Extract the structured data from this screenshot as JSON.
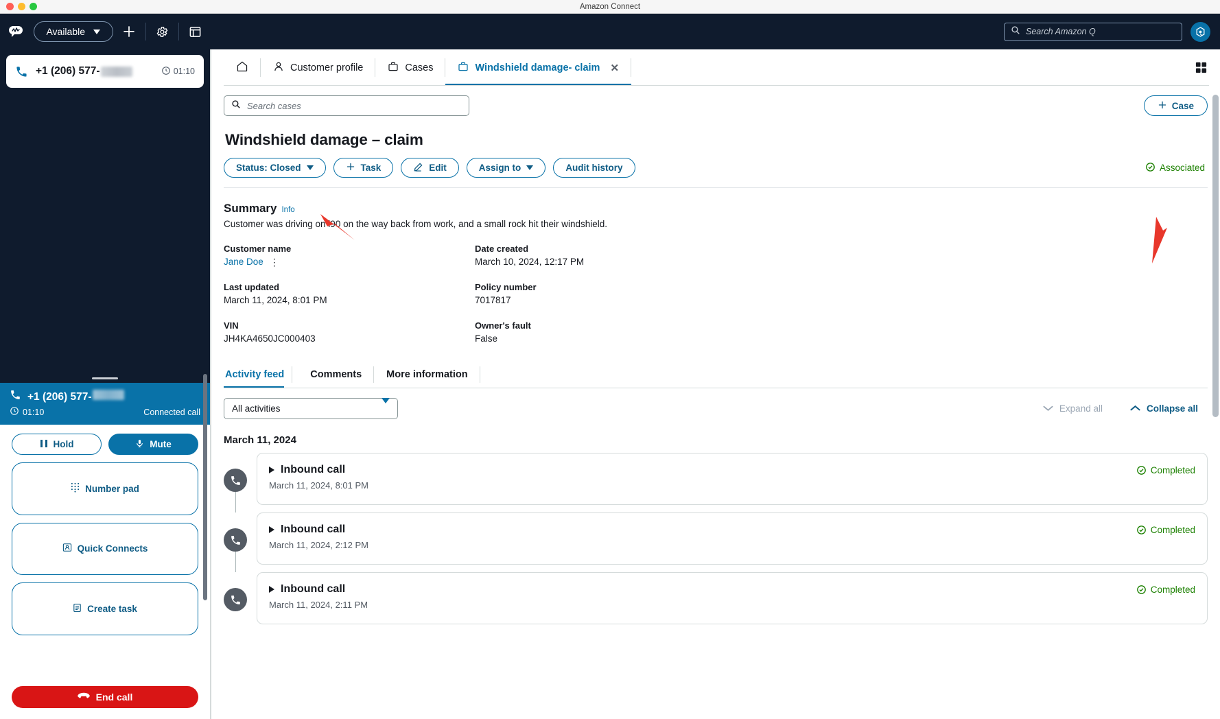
{
  "window": {
    "title": "Amazon Connect"
  },
  "topbar": {
    "logo_icon": "amazon-connect-logo-icon",
    "status": {
      "label": "Available",
      "caret_icon": "chevron-down-icon"
    },
    "add_icon": "plus-icon",
    "settings_icon": "gear-icon",
    "dashboard_icon": "dashboard-icon",
    "search": {
      "placeholder": "Search Amazon Q",
      "value": "",
      "icon": "search-icon"
    },
    "assistant_icon": "amazon-q-icon"
  },
  "contact_card": {
    "phone_icon": "phone-icon",
    "number": "+1 (206) 577-",
    "timer_icon": "clock-icon",
    "timer": "01:10"
  },
  "ccp": {
    "banner": {
      "phone_icon": "phone-icon",
      "number": "+1 (206) 577-",
      "timer_icon": "clock-icon",
      "timer": "01:10",
      "state": "Connected call"
    },
    "buttons": [
      {
        "label": "Hold",
        "icon": "pause-icon",
        "style": "outline"
      },
      {
        "label": "Mute",
        "icon": "microphone-icon",
        "style": "filled"
      },
      {
        "label": "Number pad",
        "icon": "dialpad-icon",
        "style": "outline"
      },
      {
        "label": "Quick Connects",
        "icon": "contact-card-icon",
        "style": "outline"
      },
      {
        "label": "Create task",
        "icon": "task-icon",
        "style": "outline"
      }
    ],
    "end_call": {
      "label": "End call",
      "icon": "end-call-icon"
    }
  },
  "tabs": [
    {
      "label": "",
      "icon": "home-icon",
      "active": false,
      "closable": false
    },
    {
      "label": "Customer profile",
      "icon": "user-icon",
      "active": false,
      "closable": false
    },
    {
      "label": "Cases",
      "icon": "briefcase-icon",
      "active": false,
      "closable": false
    },
    {
      "label": "Windshield damage- claim",
      "icon": "briefcase-icon",
      "active": true,
      "closable": true
    }
  ],
  "tabbar": {
    "grid_icon": "grid-view-icon",
    "close_icon": "close-icon"
  },
  "case_search": {
    "placeholder": "Search cases",
    "value": "",
    "icon": "search-icon"
  },
  "case_button": {
    "label": "Case",
    "icon": "plus-icon"
  },
  "case": {
    "title": "Windshield damage – claim",
    "actions": [
      {
        "label": "Status: Closed",
        "icon": "",
        "caret": true
      },
      {
        "label": "Task",
        "icon": "plus-icon",
        "caret": false
      },
      {
        "label": "Edit",
        "icon": "pencil-icon",
        "caret": false
      },
      {
        "label": "Assign to",
        "icon": "",
        "caret": true
      },
      {
        "label": "Audit history",
        "icon": "",
        "caret": false
      }
    ],
    "associated": {
      "label": "Associated",
      "icon": "check-circle-icon",
      "color": "#1d8102"
    },
    "summary": {
      "heading": "Summary",
      "info_link": "Info",
      "text": "Customer was driving on i90 on the way back from work, and a small rock hit their windshield."
    },
    "fields": [
      [
        {
          "label": "Customer name",
          "value": "Jane Doe",
          "is_link": true,
          "menu_icon": "kebab-menu-icon"
        },
        {
          "label": "Date created",
          "value": "March 10, 2024, 12:17 PM",
          "is_link": false
        }
      ],
      [
        {
          "label": "Last updated",
          "value": "March 11, 2024, 8:01 PM",
          "is_link": false
        },
        {
          "label": "Policy number",
          "value": "7017817",
          "is_link": false
        }
      ],
      [
        {
          "label": "VIN",
          "value": "JH4KA4650JC000403",
          "is_link": false
        },
        {
          "label": "Owner's fault",
          "value": "False",
          "is_link": false
        }
      ]
    ]
  },
  "subtabs": [
    {
      "label": "Activity feed",
      "active": true
    },
    {
      "label": "Comments",
      "active": false
    },
    {
      "label": "More information",
      "active": false
    }
  ],
  "activity_controls": {
    "filter": {
      "value": "All activities",
      "caret_icon": "chevron-down-icon"
    },
    "expand_all": {
      "label": "Expand all",
      "icon": "chevron-down-icon",
      "enabled": false
    },
    "collapse_all": {
      "label": "Collapse all",
      "icon": "chevron-up-icon",
      "enabled": true
    }
  },
  "activity_feed": {
    "day_header": "March 11, 2024",
    "items": [
      {
        "icon": "phone-icon",
        "title": "Inbound call",
        "time": "March 11, 2024, 8:01 PM",
        "status": "Completed",
        "status_icon": "check-circle-icon",
        "expand_icon": "triangle-right-icon"
      },
      {
        "icon": "phone-icon",
        "title": "Inbound call",
        "time": "March 11, 2024, 2:12 PM",
        "status": "Completed",
        "status_icon": "check-circle-icon",
        "expand_icon": "triangle-right-icon"
      },
      {
        "icon": "phone-icon",
        "title": "Inbound call",
        "time": "March 11, 2024, 2:11 PM",
        "status": "Completed",
        "status_icon": "check-circle-icon",
        "expand_icon": "triangle-right-icon"
      }
    ]
  },
  "colors": {
    "accent": "#0972a8",
    "navy": "#0f1b2d",
    "success": "#1d8102",
    "danger": "#d91515",
    "annotation": "#e8372b"
  }
}
